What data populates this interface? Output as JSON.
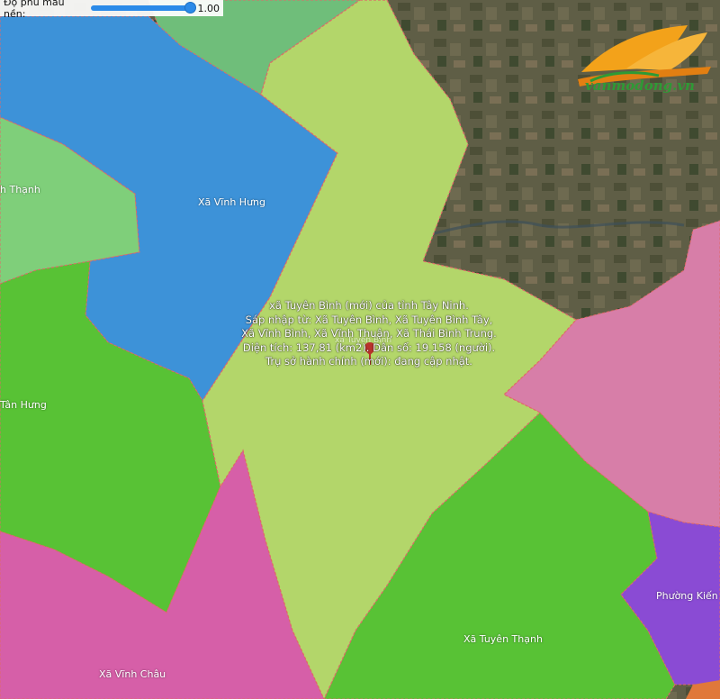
{
  "controls": {
    "opacity_label": "Độ phủ màu nền:",
    "opacity_value": "1.00",
    "opacity_level": 1.0
  },
  "colors": {
    "selected_commune": "#b3d66a",
    "light_green": "#7fcf7a",
    "blue": "#3d92d8",
    "bright_green": "#58c235",
    "pink": "#d65fa8",
    "mauve": "#d77ea8",
    "purple": "#8a4bd4",
    "satellite": "#5f5e46"
  },
  "regions": {
    "vinh_hung": "Xã Vĩnh Hưng",
    "vinh_thanh_partial": "h Thạnh",
    "tan_hung_partial": "Tân Hưng",
    "vinh_chau": "Xã Vĩnh Châu",
    "tuyen_thanh": "Xã Tuyên Thạnh",
    "phuong_kien_partial": "Phường Kiến",
    "tuyen_binh_label": "xã Tuyên Bình"
  },
  "info": {
    "line1": "xã Tuyên Bình (mới) của tỉnh Tây Ninh.",
    "line2": "Sáp nhập từ: Xã Tuyên Bình, Xã Tuyên Bình Tây,",
    "line3": "Xã Vĩnh Bình, Xã Vĩnh Thuận, Xã Thái Bình Trung.",
    "line4": "Diện tích: 137,81 (km2). Dân số: 19.158 (người).",
    "line5": "Trụ sở hành chính (mới): đang cập nhật."
  },
  "logo": {
    "text": "vanmodong.vn"
  }
}
